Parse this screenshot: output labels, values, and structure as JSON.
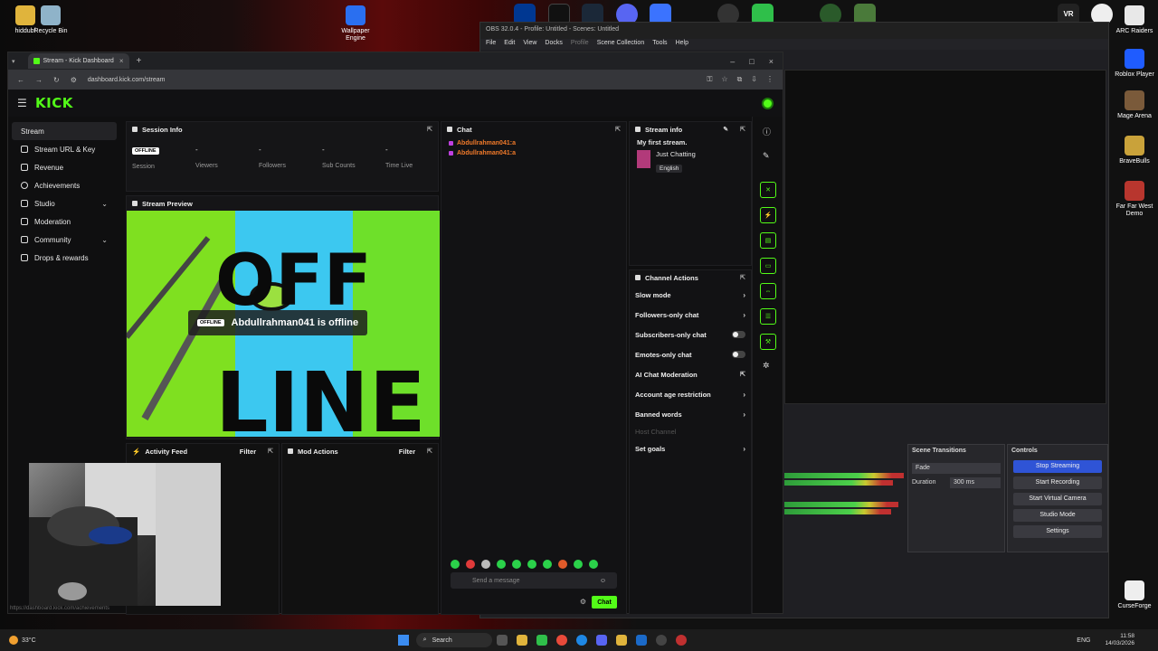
{
  "desktop": {
    "icons": [
      {
        "label": "hiddubf",
        "color": "#e0b43c"
      },
      {
        "label": "Recycle Bin",
        "color": "#8fb3c9"
      },
      {
        "label": "Wallpaper Engine",
        "color": "#2a6ff0"
      },
      {
        "label": "ARC Raiders",
        "color": "#e8e8e8"
      },
      {
        "label": "Roblox Player",
        "color": "#1f5cff"
      },
      {
        "label": "Mage Arena",
        "color": "#7a5a3a"
      },
      {
        "label": "BraveBulls",
        "color": "#c9a23a"
      },
      {
        "label": "Far Far West Demo",
        "color": "#b8362e"
      },
      {
        "label": "CurseForge",
        "color": "#eeeeee"
      }
    ],
    "top_icon_colors": [
      "#003791",
      "#111111",
      "#1b2838",
      "#5865f2",
      "#3b73ff",
      "#222222",
      "#333333",
      "#2fbf4a",
      "#4a7a3a"
    ],
    "vr_label": "VR"
  },
  "obs": {
    "title": "OBS 32.0.4 - Profile: Untitled - Scenes: Untitled",
    "menu": [
      "File",
      "Edit",
      "View",
      "Docks",
      "Profile",
      "Scene Collection",
      "Tools",
      "Help"
    ],
    "scene_transitions": {
      "title": "Scene Transitions",
      "transition": "Fade",
      "duration_label": "Duration",
      "duration_value": "300 ms"
    },
    "controls": {
      "title": "Controls",
      "buttons": [
        "Stop Streaming",
        "Start Recording",
        "Start Virtual Camera",
        "Studio Mode",
        "Settings"
      ]
    }
  },
  "browser": {
    "tab_title": "Stream - Kick Dashboard",
    "url": "dashboard.kick.com/stream",
    "status_url": "https://dashboard.kick.com/achievements"
  },
  "kick": {
    "logo": "KICK",
    "nav": [
      {
        "label": "Stream",
        "active": true,
        "expandable": false
      },
      {
        "label": "Stream URL & Key",
        "active": false,
        "expandable": false
      },
      {
        "label": "Revenue",
        "active": false,
        "expandable": false
      },
      {
        "label": "Achievements",
        "active": false,
        "expandable": false
      },
      {
        "label": "Studio",
        "active": false,
        "expandable": true
      },
      {
        "label": "Moderation",
        "active": false,
        "expandable": false
      },
      {
        "label": "Community",
        "active": false,
        "expandable": true
      },
      {
        "label": "Drops & rewards",
        "active": false,
        "expandable": false
      }
    ],
    "session_info": {
      "title": "Session Info",
      "status_badge": "OFFLINE",
      "stats": [
        {
          "value": "",
          "label": "Session"
        },
        {
          "value": "-",
          "label": "Viewers"
        },
        {
          "value": "-",
          "label": "Followers"
        },
        {
          "value": "-",
          "label": "Sub Counts"
        },
        {
          "value": "-",
          "label": "Time Live"
        }
      ]
    },
    "stream_preview": {
      "title": "Stream Preview",
      "badge": "OFFLINE",
      "message": "Abdullrahman041 is offline",
      "art_text_1": "OFF",
      "art_text_2": "LINE"
    },
    "chat": {
      "title": "Chat",
      "messages": [
        "Abdullrahman041:a",
        "Abdullrahman041:a"
      ],
      "placeholder": "Send a message",
      "send_label": "Chat"
    },
    "stream_info": {
      "title": "Stream info",
      "stream_title": "My first stream.",
      "category": "Just Chatting",
      "language": "English"
    },
    "channel_actions": {
      "title": "Channel Actions",
      "items": [
        {
          "label": "Slow mode",
          "kind": "chevron"
        },
        {
          "label": "Followers-only chat",
          "kind": "chevron"
        },
        {
          "label": "Subscribers-only chat",
          "kind": "toggle"
        },
        {
          "label": "Emotes-only chat",
          "kind": "toggle"
        },
        {
          "label": "AI Chat Moderation",
          "kind": "external"
        },
        {
          "label": "Account age restriction",
          "kind": "chevron"
        },
        {
          "label": "Banned words",
          "kind": "chevron"
        },
        {
          "label": "Host Channel",
          "kind": "disabled"
        },
        {
          "label": "Set goals",
          "kind": "chevron"
        }
      ]
    },
    "activity_feed": {
      "title": "Activity Feed",
      "filter": "Filter"
    },
    "mod_actions": {
      "title": "Mod Actions",
      "filter": "Filter"
    }
  },
  "taskbar": {
    "weather": "33°C",
    "search": "Search",
    "lang": "ENG",
    "time": "11:58",
    "date": "14/03/2026"
  }
}
